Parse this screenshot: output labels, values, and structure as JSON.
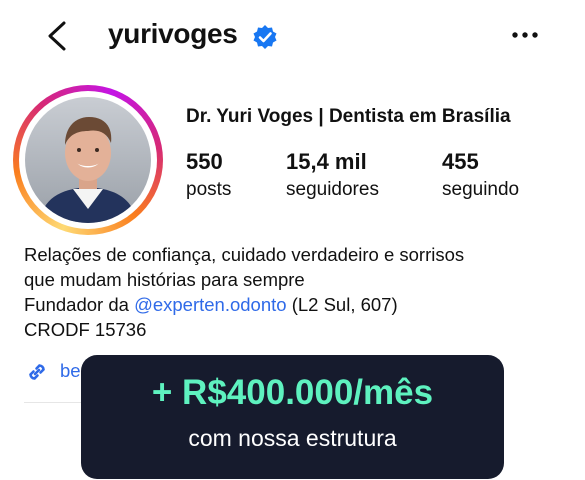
{
  "header": {
    "username": "yurivoges",
    "verified_icon": "verified-badge-icon",
    "back_icon": "chevron-left-icon",
    "more_icon": "more-horizontal-icon"
  },
  "profile": {
    "display_name": "Dr. Yuri Voges | Dentista em Brasília",
    "stats": [
      {
        "value": "550",
        "label": "posts"
      },
      {
        "value": "15,4 mil",
        "label": "seguidores"
      },
      {
        "value": "455",
        "label": "seguindo"
      }
    ],
    "bio": {
      "line1": "Relações de confiança, cuidado verdadeiro e sorrisos",
      "line2": "que mudam histórias para sempre",
      "line3_prefix": "Fundador da ",
      "mention": "@experten.odonto",
      "line3_suffix": " (L2 Sul, 607)",
      "line4": "CRODF 15736"
    },
    "link": {
      "icon": "link-icon",
      "text": "be"
    }
  },
  "promo": {
    "headline": "+ R$400.000/mês",
    "subtext": "com nossa estrutura"
  },
  "colors": {
    "verified_blue": "#1877f2",
    "link_blue": "#2f6ae8",
    "promo_bg": "#161b2d",
    "promo_accent": "#5ef2bf"
  }
}
